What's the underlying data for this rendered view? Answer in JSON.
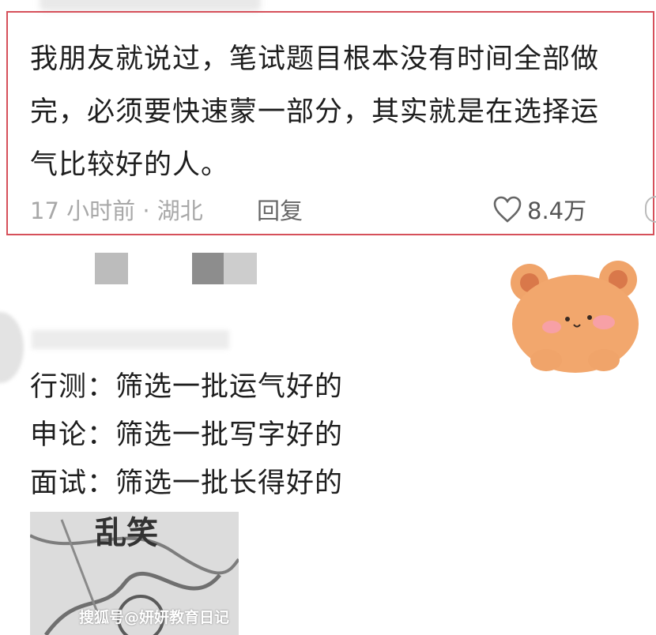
{
  "comment": {
    "text_lines": [
      "我朋友就说过，笔试题目根本没有时间全部做",
      "完，必须要快速蒙一部分，其实就是在选择运",
      "气比较好的人。"
    ],
    "time_location": "17 小时前 · 湖北",
    "reply_label": "回复",
    "likes": "8.4万"
  },
  "reply": {
    "lines": [
      "行测：筛选一批运气好的",
      "申论：筛选一批写字好的",
      "面试：筛选一批长得好的"
    ]
  },
  "photo": {
    "caption": "乱笑"
  },
  "watermark": "搜狐号@妍妍教育日记",
  "colors": {
    "highlight_border": "#d6505a",
    "meta_text": "#a8a8a8",
    "bear": "#f0a46a"
  },
  "icons": {
    "like": "heart-icon",
    "more": "more-icon",
    "sticker": "bear-sticker"
  }
}
